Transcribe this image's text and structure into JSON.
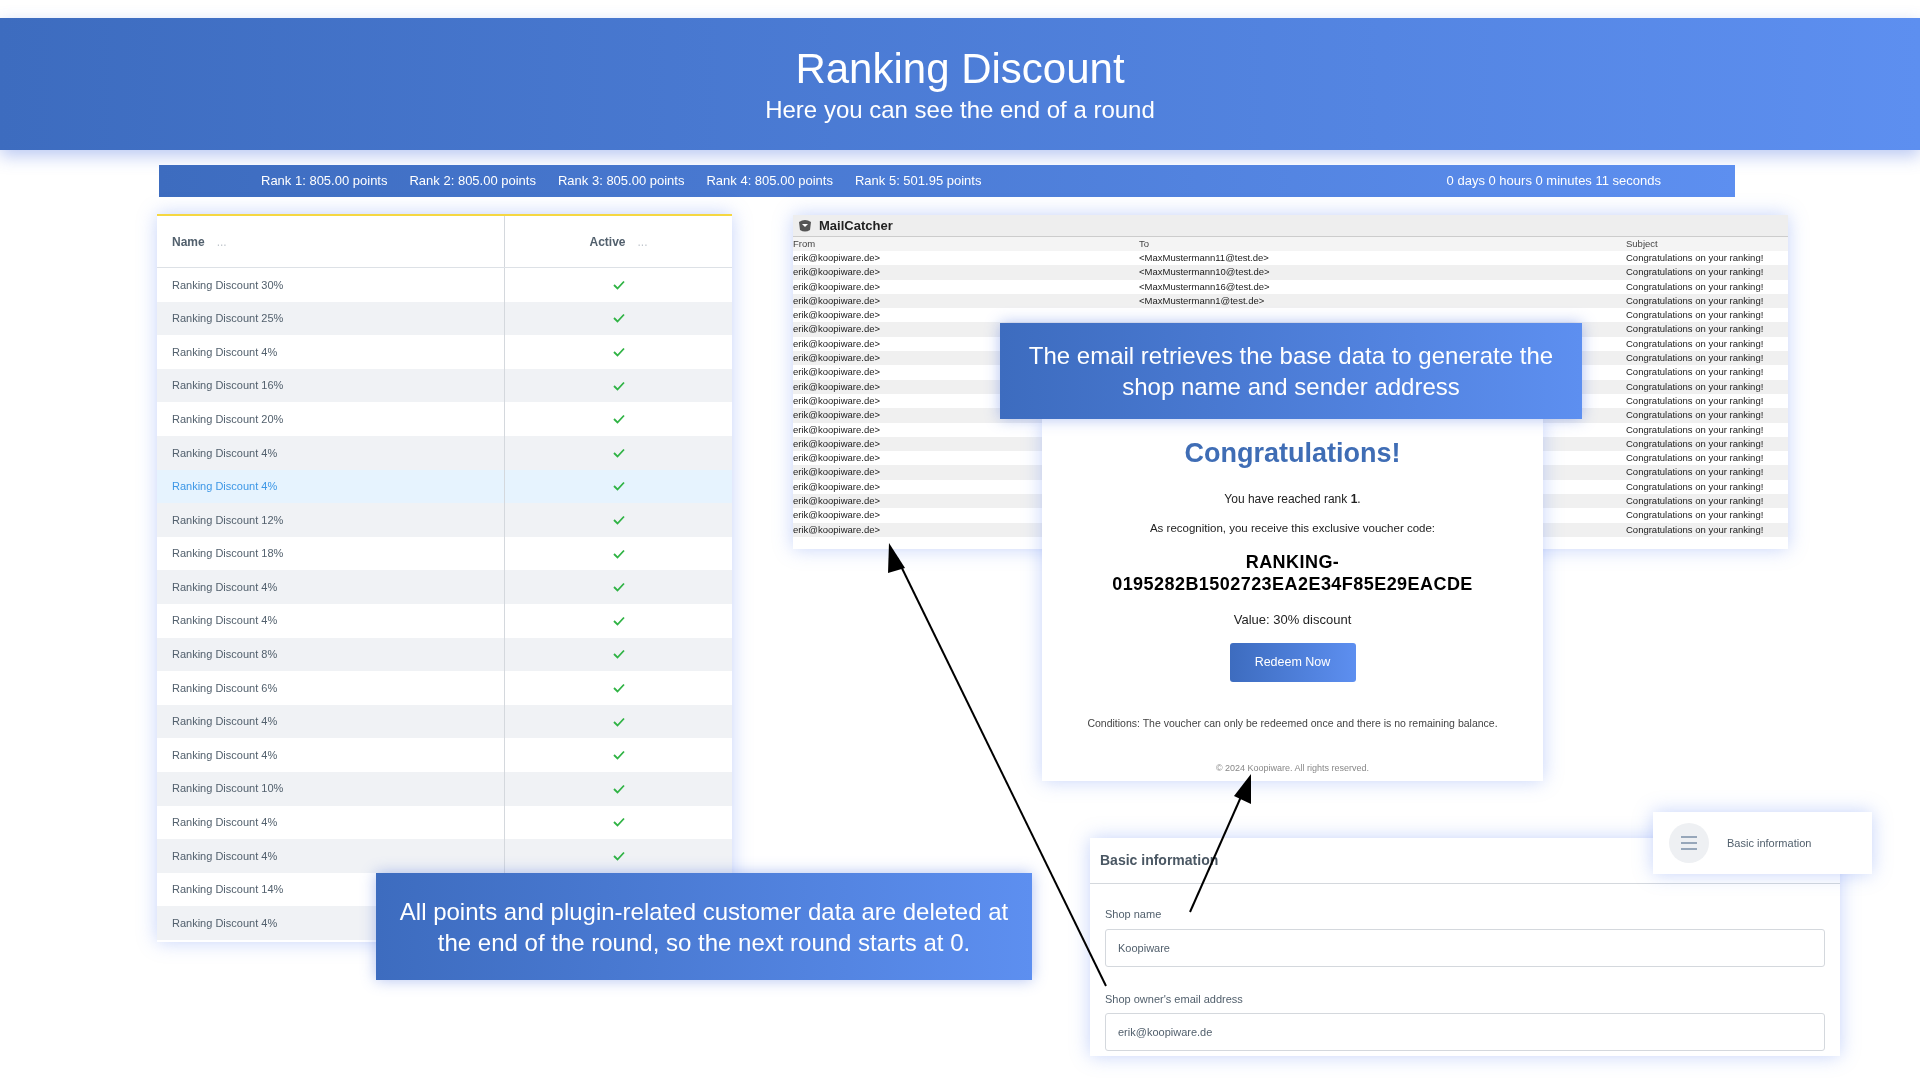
{
  "header": {
    "title": "Ranking Discount",
    "subtitle": "Here you can see the end of a round"
  },
  "rank_bar": {
    "ranks": [
      "Rank 1: 805.00 points",
      "Rank 2: 805.00 points",
      "Rank 3: 805.00 points",
      "Rank 4: 805.00 points",
      "Rank 5: 501.95 points"
    ],
    "timer": "0 days 0 hours 0 minutes 11 seconds"
  },
  "table": {
    "columns": [
      "Name",
      "Active"
    ],
    "column_menu": "...",
    "rows": [
      {
        "name": "Ranking Discount 30%",
        "active": true,
        "selected": false
      },
      {
        "name": "Ranking Discount 25%",
        "active": true,
        "selected": false
      },
      {
        "name": "Ranking Discount 4%",
        "active": true,
        "selected": false
      },
      {
        "name": "Ranking Discount 16%",
        "active": true,
        "selected": false
      },
      {
        "name": "Ranking Discount 20%",
        "active": true,
        "selected": false
      },
      {
        "name": "Ranking Discount 4%",
        "active": true,
        "selected": false
      },
      {
        "name": "Ranking Discount 4%",
        "active": true,
        "selected": true
      },
      {
        "name": "Ranking Discount 12%",
        "active": true,
        "selected": false
      },
      {
        "name": "Ranking Discount 18%",
        "active": true,
        "selected": false
      },
      {
        "name": "Ranking Discount 4%",
        "active": true,
        "selected": false
      },
      {
        "name": "Ranking Discount 4%",
        "active": true,
        "selected": false
      },
      {
        "name": "Ranking Discount 8%",
        "active": true,
        "selected": false
      },
      {
        "name": "Ranking Discount 6%",
        "active": true,
        "selected": false
      },
      {
        "name": "Ranking Discount 4%",
        "active": true,
        "selected": false
      },
      {
        "name": "Ranking Discount 4%",
        "active": true,
        "selected": false
      },
      {
        "name": "Ranking Discount 10%",
        "active": true,
        "selected": false
      },
      {
        "name": "Ranking Discount 4%",
        "active": true,
        "selected": false
      },
      {
        "name": "Ranking Discount 4%",
        "active": true,
        "selected": false
      },
      {
        "name": "Ranking Discount 14%",
        "selected": false
      },
      {
        "name": "Ranking Discount 4%",
        "selected": false
      }
    ]
  },
  "mailcatcher": {
    "title": "MailCatcher",
    "columns": [
      "From",
      "To",
      "Subject"
    ],
    "rows": [
      {
        "from": "erik@koopiware.de>",
        "to": "<MaxMustermann11@test.de>",
        "subject": "Congratulations on your ranking!"
      },
      {
        "from": "erik@koopiware.de>",
        "to": "<MaxMustermann10@test.de>",
        "subject": "Congratulations on your ranking!"
      },
      {
        "from": "erik@koopiware.de>",
        "to": "<MaxMustermann16@test.de>",
        "subject": "Congratulations on your ranking!"
      },
      {
        "from": "erik@koopiware.de>",
        "to": "<MaxMustermann1@test.de>",
        "subject": "Congratulations on your ranking!"
      },
      {
        "from": "erik@koopiware.de>",
        "subject": "Congratulations on your ranking!"
      },
      {
        "from": "erik@koopiware.de>",
        "subject": "Congratulations on your ranking!"
      },
      {
        "from": "erik@koopiware.de>",
        "subject": "Congratulations on your ranking!"
      },
      {
        "from": "erik@koopiware.de>",
        "subject": "Congratulations on your ranking!"
      },
      {
        "from": "erik@koopiware.de>",
        "subject": "Congratulations on your ranking!"
      },
      {
        "from": "erik@koopiware.de>",
        "subject": "Congratulations on your ranking!"
      },
      {
        "from": "erik@koopiware.de>",
        "subject": "Congratulations on your ranking!"
      },
      {
        "from": "erik@koopiware.de>",
        "subject": "Congratulations on your ranking!"
      },
      {
        "from": "erik@koopiware.de>",
        "subject": "Congratulations on your ranking!"
      },
      {
        "from": "erik@koopiware.de>",
        "subject": "Congratulations on your ranking!"
      },
      {
        "from": "erik@koopiware.de>",
        "subject": "Congratulations on your ranking!"
      },
      {
        "from": "erik@koopiware.de>",
        "subject": "Congratulations on your ranking!"
      },
      {
        "from": "erik@koopiware.de>",
        "subject": "Congratulations on your ranking!"
      },
      {
        "from": "erik@koopiware.de>",
        "subject": "Congratulations on your ranking!"
      },
      {
        "from": "erik@koopiware.de>",
        "subject": "Congratulations on your ranking!"
      },
      {
        "from": "erik@koopiware.de>",
        "subject": "Congratulations on your ranking!"
      }
    ]
  },
  "callout_email": "The email retrieves the base data to generate the shop name and sender address",
  "email": {
    "heading": "Congratulations!",
    "rank_line": "You have reached rank **1**.",
    "intro": "As recognition, you receive this exclusive voucher code:",
    "code": "RANKING-0195282B1502723EA2E34F85E29EACDE",
    "value": "Value: 30% discount",
    "button": "Redeem Now",
    "conditions": "Conditions: The voucher can only be redeemed once and there is no remaining balance.",
    "footer": "© 2024 Koopiware. All rights reserved."
  },
  "basic_info": {
    "title": "Basic information",
    "fields": [
      {
        "label": "Shop name",
        "value": "Koopiware"
      },
      {
        "label": "Shop owner's email address",
        "value": "erik@koopiware.de"
      }
    ]
  },
  "nav_tab": {
    "label": "Basic information"
  },
  "callout_round": "All points and plugin-related customer data are deleted at the end of the round, so the next round starts at 0."
}
